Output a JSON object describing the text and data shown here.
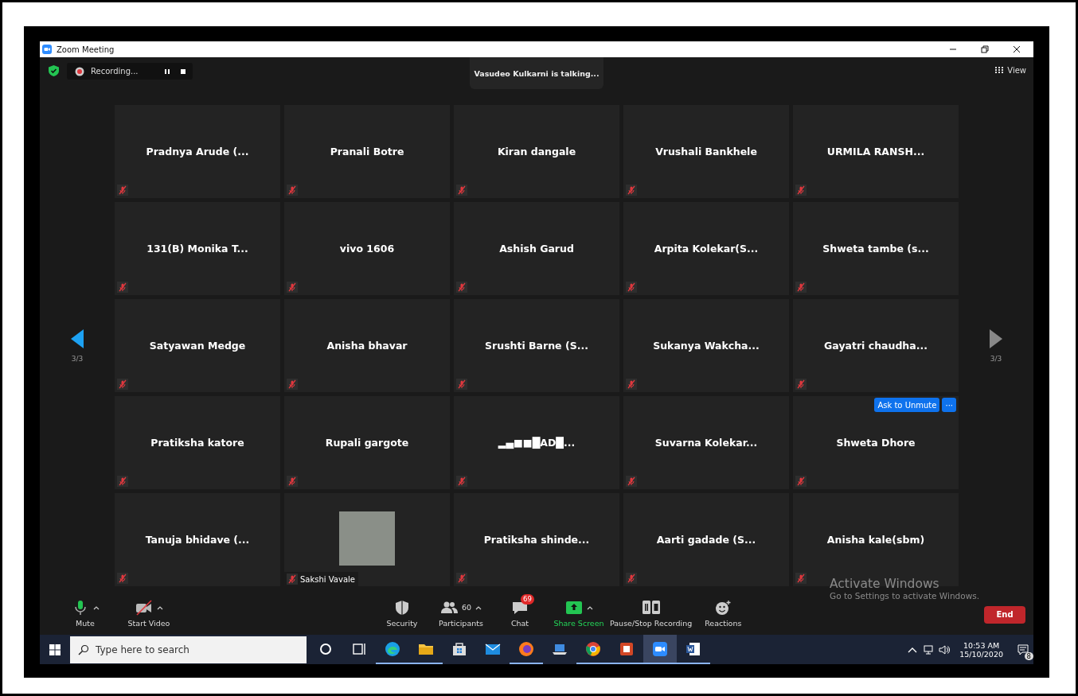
{
  "window": {
    "title": "Zoom Meeting"
  },
  "top_bar": {
    "recording": {
      "label": "Recording..."
    },
    "talking": "Vasudeo Kulkarni is talking...",
    "view": "View"
  },
  "pager": {
    "previous": {
      "label": "3/3",
      "disabled": false
    },
    "next": {
      "label": "3/3",
      "disabled": true
    }
  },
  "tiles": [
    {
      "name": "Pradnya Arude (...",
      "muted": true,
      "kind": "name"
    },
    {
      "name": "Pranali Botre",
      "muted": true,
      "kind": "name"
    },
    {
      "name": "Kiran dangale",
      "muted": true,
      "kind": "name"
    },
    {
      "name": "Vrushali Bankhele",
      "muted": true,
      "kind": "name"
    },
    {
      "name": "URMILA  RANSH...",
      "muted": true,
      "kind": "name"
    },
    {
      "name": "131(B) Monika T...",
      "muted": true,
      "kind": "name"
    },
    {
      "name": "vivo 1606",
      "muted": true,
      "kind": "name"
    },
    {
      "name": "Ashish Garud",
      "muted": true,
      "kind": "name"
    },
    {
      "name": "Arpita  Kolekar(S...",
      "muted": true,
      "kind": "name"
    },
    {
      "name": "Shweta tambe (s...",
      "muted": true,
      "kind": "name"
    },
    {
      "name": "Satyawan Medge",
      "muted": true,
      "kind": "name"
    },
    {
      "name": "Anisha bhavar",
      "muted": true,
      "kind": "name"
    },
    {
      "name": "Srushti Barne  (S...",
      "muted": true,
      "kind": "name"
    },
    {
      "name": "Sukanya  Wakcha...",
      "muted": true,
      "kind": "name"
    },
    {
      "name": "Gayatri  chaudha...",
      "muted": true,
      "kind": "name"
    },
    {
      "name": "Pratiksha katore",
      "muted": true,
      "kind": "name"
    },
    {
      "name": "Rupali gargote",
      "muted": true,
      "kind": "name"
    },
    {
      "name": "▂▄■■█AD█...",
      "muted": true,
      "kind": "name"
    },
    {
      "name": "Suvarna  Kolekar...",
      "muted": true,
      "kind": "name"
    },
    {
      "name": "Shweta Dhore",
      "muted": true,
      "kind": "name",
      "actions": [
        {
          "label": "Ask to Unmute"
        },
        {
          "label": "···"
        }
      ]
    },
    {
      "name": "Tanuja  bhidave  (...",
      "muted": true,
      "kind": "name"
    },
    {
      "name": "Sakshi Vavale",
      "muted": true,
      "kind": "video"
    },
    {
      "name": "Pratiksha  shinde...",
      "muted": true,
      "kind": "name"
    },
    {
      "name": "Aarti gadade (S...",
      "muted": true,
      "kind": "name"
    },
    {
      "name": "Anisha kale(sbm)",
      "muted": true,
      "kind": "name"
    }
  ],
  "toolbar": {
    "items": [
      {
        "kind": "mic",
        "label": "Mute",
        "caret": true
      },
      {
        "kind": "video-off",
        "label": "Start Video",
        "caret": true
      },
      {
        "kind": "security",
        "label": "Security",
        "caret": false
      },
      {
        "kind": "participants",
        "label": "Participants",
        "count": "60",
        "caret": true
      },
      {
        "kind": "chat",
        "label": "Chat",
        "badge": "69",
        "caret": false
      },
      {
        "kind": "share",
        "label": "Share Screen",
        "caret": true
      },
      {
        "kind": "recording",
        "label": "Pause/Stop Recording",
        "caret": false
      },
      {
        "kind": "reactions",
        "label": "Reactions",
        "caret": false
      }
    ],
    "end": "End"
  },
  "activation_notice": {
    "title": "Activate Windows",
    "text": "Go to Settings to activate Windows."
  },
  "taskbar": {
    "search_placeholder": "Type here to search",
    "apps": [
      {
        "kind": "cortana",
        "running": false,
        "selected": false
      },
      {
        "kind": "taskview",
        "running": false,
        "selected": false
      },
      {
        "kind": "edge",
        "running": true,
        "selected": false
      },
      {
        "kind": "folder",
        "running": true,
        "selected": false
      },
      {
        "kind": "store",
        "running": false,
        "selected": false
      },
      {
        "kind": "mail",
        "running": false,
        "selected": false
      },
      {
        "kind": "firefox",
        "running": true,
        "selected": false
      },
      {
        "kind": "laptop",
        "running": false,
        "selected": false
      },
      {
        "kind": "chrome",
        "running": true,
        "selected": false
      },
      {
        "kind": "office",
        "running": true,
        "selected": false
      },
      {
        "kind": "zoom",
        "running": true,
        "selected": true
      },
      {
        "kind": "word",
        "running": true,
        "selected": false
      }
    ],
    "time": "10:53 AM",
    "date": "15/10/2020",
    "notifications": "8"
  }
}
